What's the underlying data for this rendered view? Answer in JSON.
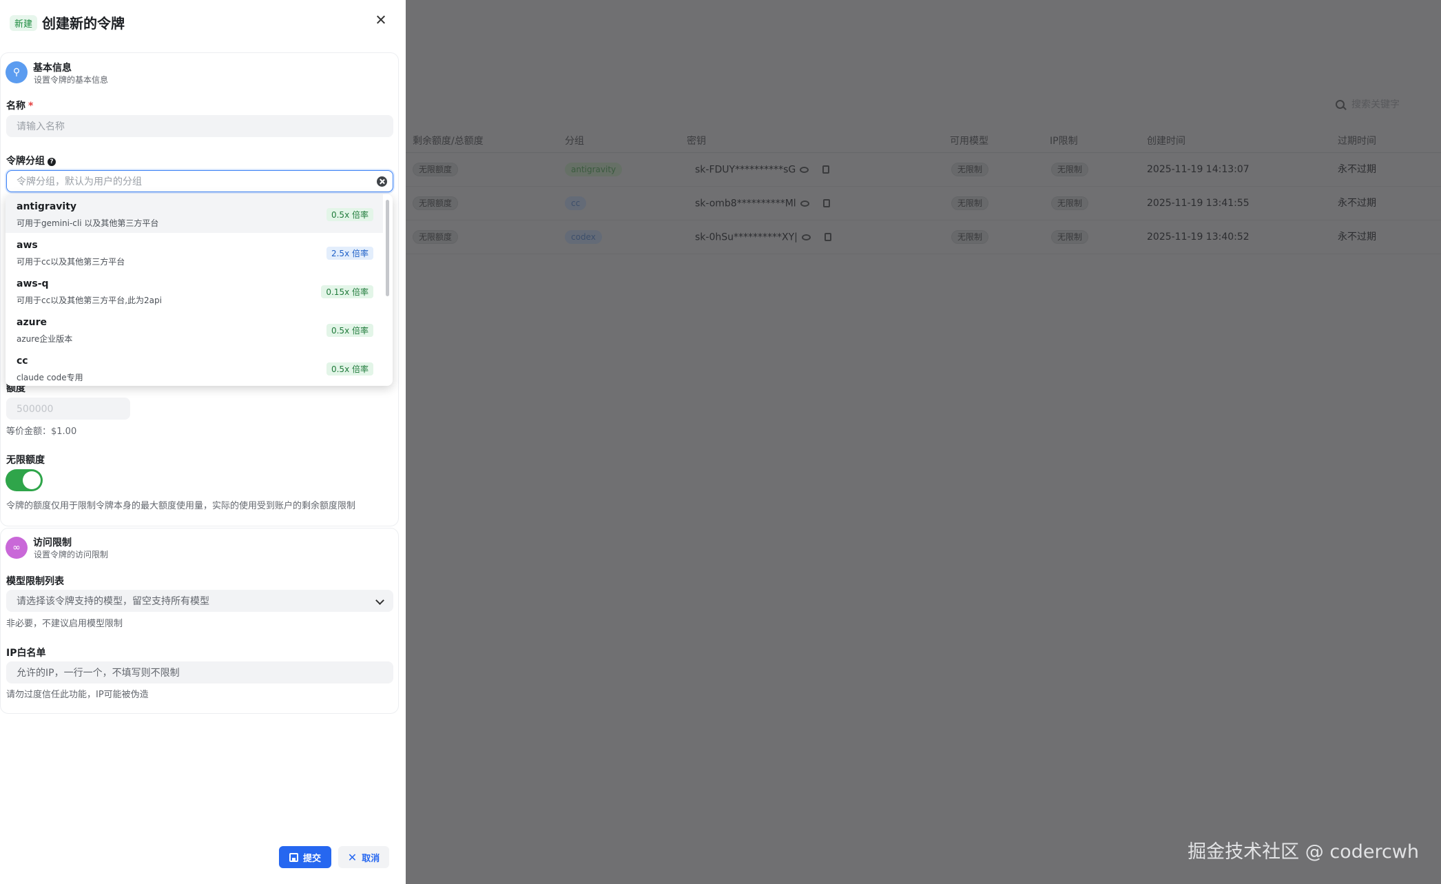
{
  "sheet": {
    "badge": "新建",
    "title": "创建新的令牌"
  },
  "basic": {
    "icon": "key-icon",
    "title": "基本信息",
    "subtitle": "设置令牌的基本信息",
    "name_label": "名称",
    "required_mark": "*",
    "name_placeholder": "请输入名称",
    "group_label": "令牌分组",
    "group_placeholder": "令牌分组，默认为用户的分组"
  },
  "group_options": [
    {
      "name": "antigravity",
      "desc": "可用于gemini-cli 以及其他第三方平台",
      "rate": "0.5x 倍率",
      "color": "green"
    },
    {
      "name": "aws",
      "desc": "可用于cc以及其他第三方平台",
      "rate": "2.5x 倍率",
      "color": "blue"
    },
    {
      "name": "aws-q",
      "desc": "可用于cc以及其他第三方平台,此为2api",
      "rate": "0.15x 倍率",
      "color": "green"
    },
    {
      "name": "azure",
      "desc": "azure企业版本",
      "rate": "0.5x 倍率",
      "color": "green"
    },
    {
      "name": "cc",
      "desc": "claude code专用",
      "rate": "0.5x 倍率",
      "color": "green"
    }
  ],
  "quota": {
    "label": "额度",
    "value_placeholder": "500000",
    "equivalent": "等价金额：$1.00",
    "unlimited_label": "无限额度",
    "unlimited_on": true,
    "note": "令牌的额度仅用于限制令牌本身的最大额度使用量，实际的使用受到账户的剩余额度限制"
  },
  "access": {
    "icon": "link-icon",
    "title": "访问限制",
    "subtitle": "设置令牌的访问限制",
    "models_label": "模型限制列表",
    "models_placeholder": "请选择该令牌支持的模型，留空支持所有模型",
    "models_hint": "非必要，不建议启用模型限制",
    "ip_label": "IP白名单",
    "ip_placeholder": "允许的IP，一行一个，不填写则不限制",
    "ip_hint": "请勿过度信任此功能，IP可能被伪造"
  },
  "actions": {
    "submit": "提交",
    "cancel": "取消"
  },
  "background": {
    "search_placeholder": "搜索关键字",
    "headers": [
      "剩余额度/总额度",
      "分组",
      "密钥",
      "可用模型",
      "IP限制",
      "创建时间",
      "过期时间"
    ],
    "rows": [
      {
        "quota": "无限额度",
        "group": "antigravity",
        "key": "sk-FDUY**********sG",
        "models": "无限制",
        "ip": "无限制",
        "created": "2025-11-19 14:13:07",
        "expires": "永不过期"
      },
      {
        "quota": "无限额度",
        "group": "cc",
        "key": "sk-omb8**********Ml",
        "models": "无限制",
        "ip": "无限制",
        "created": "2025-11-19 13:41:55",
        "expires": "永不过期"
      },
      {
        "quota": "无限额度",
        "group": "codex",
        "key": "sk-0hSu**********XY|",
        "models": "无限制",
        "ip": "无限制",
        "created": "2025-11-19 13:40:52",
        "expires": "永不过期"
      }
    ]
  },
  "watermark": "掘金技术社区 @ codercwh"
}
